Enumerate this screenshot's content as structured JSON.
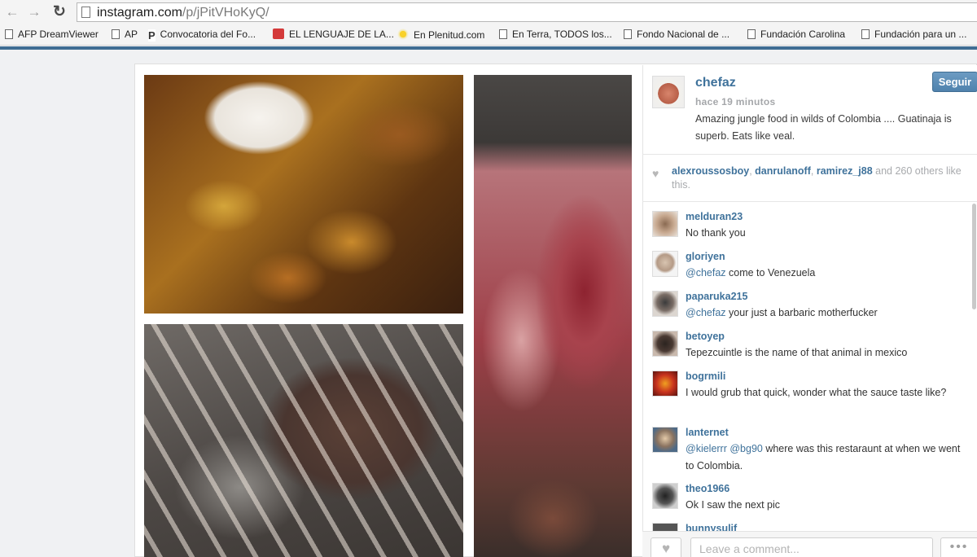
{
  "browser": {
    "url_host": "instagram.com",
    "url_path": "/p/jPitVHoKyQ/",
    "bookmarks": [
      {
        "label": "AFP DreamViewer",
        "icon": "page-icon"
      },
      {
        "label": "AP",
        "icon": "page-icon"
      },
      {
        "label": "Convocatoria del Fo...",
        "icon": "p-logo-icon"
      },
      {
        "label": "EL LENGUAJE DE LA...",
        "icon": "red-logo-icon"
      },
      {
        "label": "En Plenitud.com",
        "icon": "sun-icon"
      },
      {
        "label": "En Terra, TODOS los...",
        "icon": "page-icon"
      },
      {
        "label": "Fondo Nacional de ...",
        "icon": "page-icon"
      },
      {
        "label": "Fundación Carolina",
        "icon": "page-icon"
      },
      {
        "label": "Fundación para un ...",
        "icon": "page-icon"
      }
    ]
  },
  "post": {
    "owner": "chefaz",
    "time": "hace 19 minutos",
    "caption": "Amazing jungle food in wilds of Colombia .... Guatinaja is superb. Eats like veal.",
    "follow_label": "Seguir",
    "likers": [
      "alexroussosboy",
      "danrulanoff",
      "ramirez_j88"
    ],
    "likes_sep1": ", ",
    "likes_sep2": ", ",
    "likes_rest": " and 260 others like this."
  },
  "comments": [
    {
      "user": "melduran23",
      "mention": "",
      "text": "No thank you"
    },
    {
      "user": "gloriyen",
      "mention": "@chefaz",
      "text": " come to Venezuela"
    },
    {
      "user": "paparuka215",
      "mention": "@chefaz",
      "text": " your just a barbaric motherfucker"
    },
    {
      "user": "betoyep",
      "mention": "",
      "text": "Tepezcuintle is the name of that animal in mexico"
    },
    {
      "user": "bogrmili",
      "mention": "",
      "text": "I would grub that quick, wonder what the sauce taste like?"
    },
    {
      "user": "lanternet",
      "mention": "@kielerrr @bg90",
      "text": " where was this restaraunt at when we went to Colombia."
    },
    {
      "user": "theo1966",
      "mention": "",
      "text": "Ok I saw the next pic"
    },
    {
      "user": "bunnysulif",
      "mention": "",
      "text": ""
    }
  ],
  "composer": {
    "placeholder": "Leave a comment...",
    "more_label": "•••"
  },
  "colors": {
    "link": "#3f729b",
    "follow_button": "#4f82ad"
  }
}
